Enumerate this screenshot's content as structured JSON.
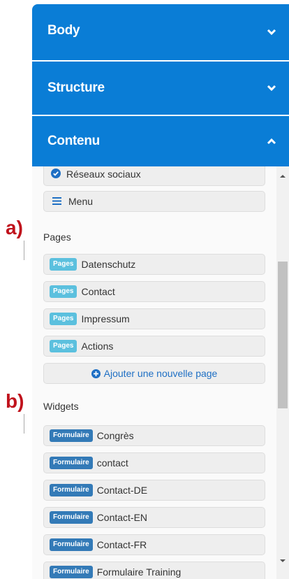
{
  "accordion": {
    "body": "Body",
    "structure": "Structure",
    "contenu": "Contenu"
  },
  "items_top": [
    {
      "label": "Réseaux sociaux",
      "icon": "check-circle-icon"
    },
    {
      "label": "Menu",
      "icon": "hamburger-menu-icon"
    }
  ],
  "annotations": {
    "a": "a)",
    "b": "b)"
  },
  "pages": {
    "title": "Pages",
    "badge": "Pages",
    "items": [
      "Datenschutz",
      "Contact",
      "Impressum",
      "Actions"
    ],
    "add_label": "Ajouter une nouvelle page"
  },
  "widgets": {
    "title": "Widgets",
    "badge": "Formulaire",
    "items": [
      "Congrès",
      "contact",
      "Contact-DE",
      "Contact-EN",
      "Contact-FR",
      "Formulaire Training"
    ]
  },
  "colors": {
    "header_bg": "#0a7dd6",
    "pages_badge": "#5bc0de",
    "form_badge": "#337ab7",
    "add_link": "#1e6fc4",
    "annotation": "#c0121c"
  }
}
